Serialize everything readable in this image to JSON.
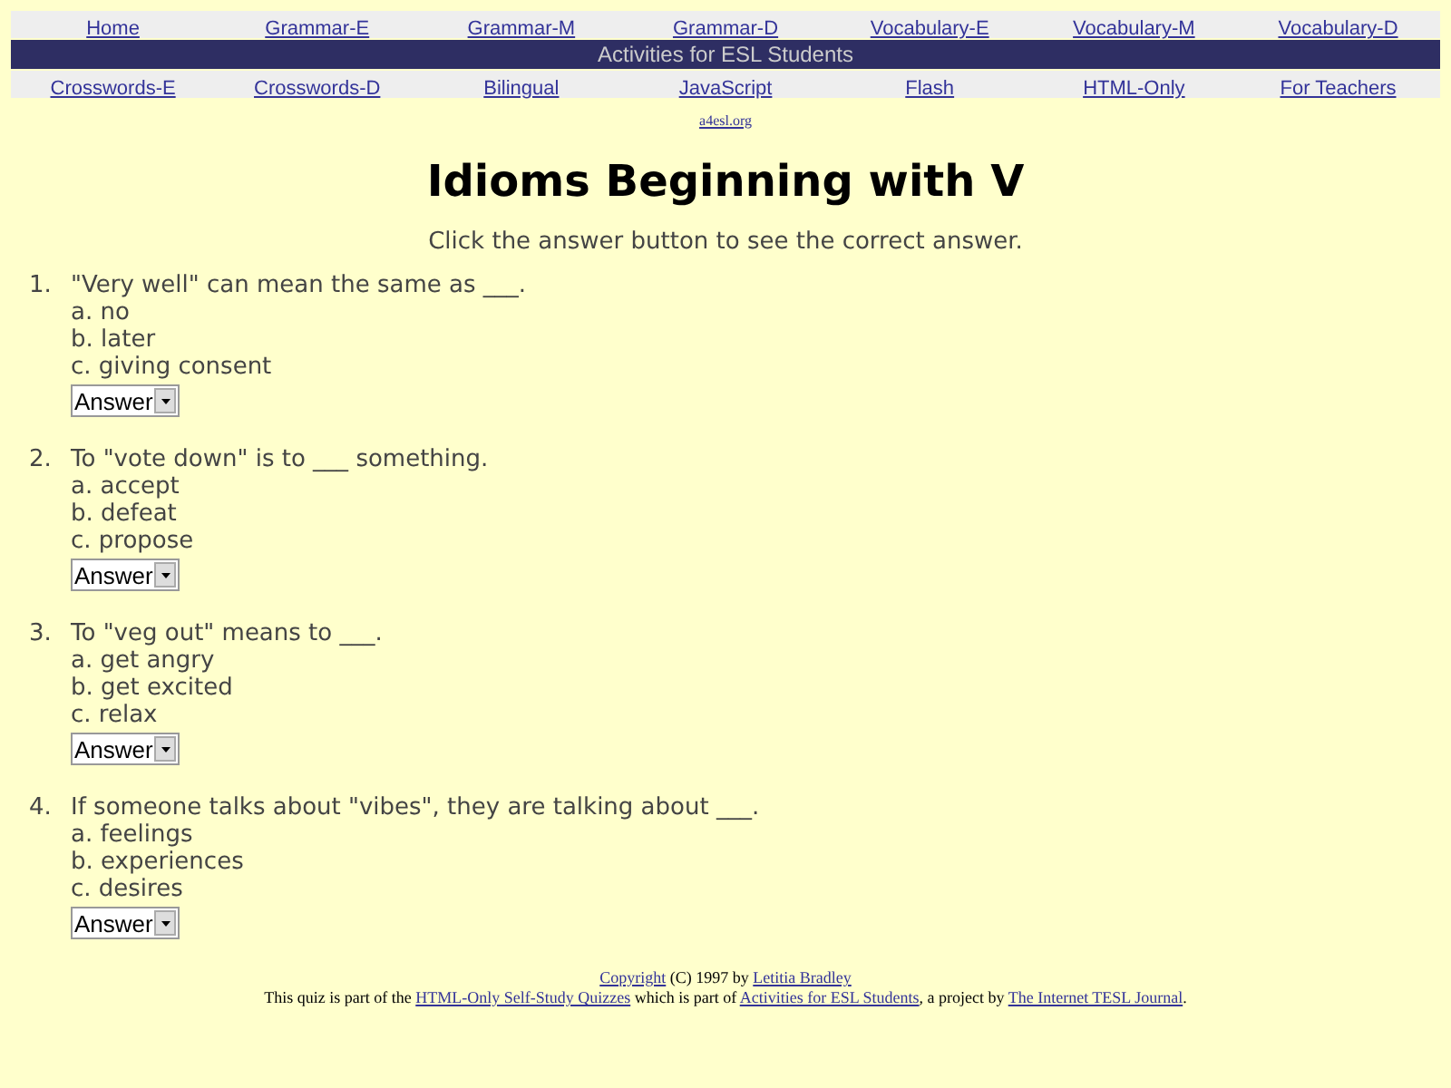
{
  "nav_top": [
    "Home",
    "Grammar-E",
    "Grammar-M",
    "Grammar-D",
    "Vocabulary-E",
    "Vocabulary-M",
    "Vocabulary-D"
  ],
  "banner": "Activities for ESL Students",
  "nav_bottom": [
    "Crosswords-E",
    "Crosswords-D",
    "Bilingual",
    "JavaScript",
    "Flash",
    "HTML-Only",
    "For Teachers"
  ],
  "site_link": "a4esl.org",
  "title": "Idioms Beginning with V",
  "instructions": "Click the answer button to see the correct answer.",
  "questions": [
    {
      "number": "1.",
      "text": "\"Very well\" can mean the same as ___.",
      "options": [
        "a. no",
        "b. later",
        "c. giving consent"
      ],
      "answer_select": "Answer"
    },
    {
      "number": "2.",
      "text": "To \"vote down\" is to ___ something.",
      "options": [
        "a. accept",
        "b. defeat",
        "c. propose"
      ],
      "answer_select": "Answer"
    },
    {
      "number": "3.",
      "text": "To \"veg out\" means to ___.",
      "options": [
        "a. get angry",
        "b. get excited",
        "c. relax"
      ],
      "answer_select": "Answer"
    },
    {
      "number": "4.",
      "text": "If someone talks about \"vibes\", they are talking about ___.",
      "options": [
        "a. feelings",
        "b. experiences",
        "c. desires"
      ],
      "answer_select": "Answer"
    }
  ],
  "footer": [
    [
      {
        "text": "Copyright",
        "link": true
      },
      {
        "text": " (C) 1997 by ",
        "link": false
      },
      {
        "text": "Letitia Bradley",
        "link": true
      }
    ],
    [
      {
        "text": "This quiz is part of the ",
        "link": false
      },
      {
        "text": "HTML-Only Self-Study Quizzes",
        "link": true
      },
      {
        "text": " which is part of ",
        "link": false
      },
      {
        "text": "Activities for ESL Students",
        "link": true
      },
      {
        "text": ", a project by ",
        "link": false
      },
      {
        "text": "The Internet TESL Journal",
        "link": true
      },
      {
        "text": ".",
        "link": false
      }
    ]
  ]
}
